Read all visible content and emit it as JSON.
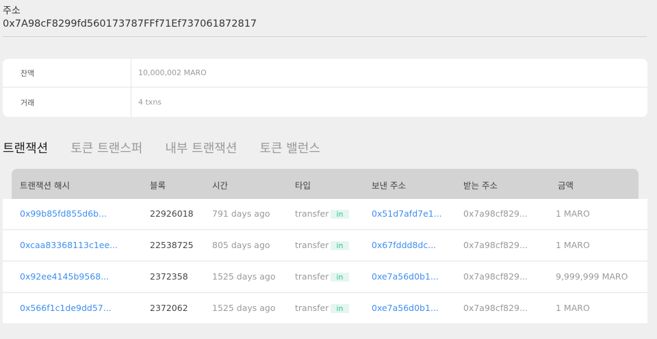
{
  "address": {
    "label": "주소",
    "value": "0x7A98cF8299fd560173787FFf71Ef737061872817"
  },
  "info": [
    {
      "label": "잔액",
      "value": "10,000,002 MARO"
    },
    {
      "label": "거래",
      "value": "4 txns"
    }
  ],
  "tabs": [
    {
      "label": "트랜잭션",
      "active": true
    },
    {
      "label": "토큰 트랜스퍼",
      "active": false
    },
    {
      "label": "내부 트랜잭션",
      "active": false
    },
    {
      "label": "토큰 밸런스",
      "active": false
    }
  ],
  "table": {
    "headers": [
      "트랜잭션 해시",
      "블록",
      "시간",
      "타입",
      "보낸 주소",
      "받는 주소",
      "금액"
    ],
    "rows": [
      {
        "hash": "0x99b85fd855d6b...",
        "block": "22926018",
        "time": "791 days ago",
        "type": "transfer",
        "dir": "in",
        "from": "0x51d7afd7e1...",
        "to": "0x7a98cf829...",
        "amount": "1 MARO"
      },
      {
        "hash": "0xcaa83368113c1ee...",
        "block": "22538725",
        "time": "805 days ago",
        "type": "transfer",
        "dir": "in",
        "from": "0x67fddd8dc...",
        "to": "0x7a98cf829...",
        "amount": "1 MARO"
      },
      {
        "hash": "0x92ee4145b9568...",
        "block": "2372358",
        "time": "1525 days ago",
        "type": "transfer",
        "dir": "in",
        "from": "0xe7a56d0b1...",
        "to": "0x7a98cf829...",
        "amount": "9,999,999 MARO"
      },
      {
        "hash": "0x566f1c1de9dd57...",
        "block": "2372062",
        "time": "1525 days ago",
        "type": "transfer",
        "dir": "in",
        "from": "0xe7a56d0b1...",
        "to": "0x7a98cf829...",
        "amount": "1 MARO"
      }
    ]
  }
}
